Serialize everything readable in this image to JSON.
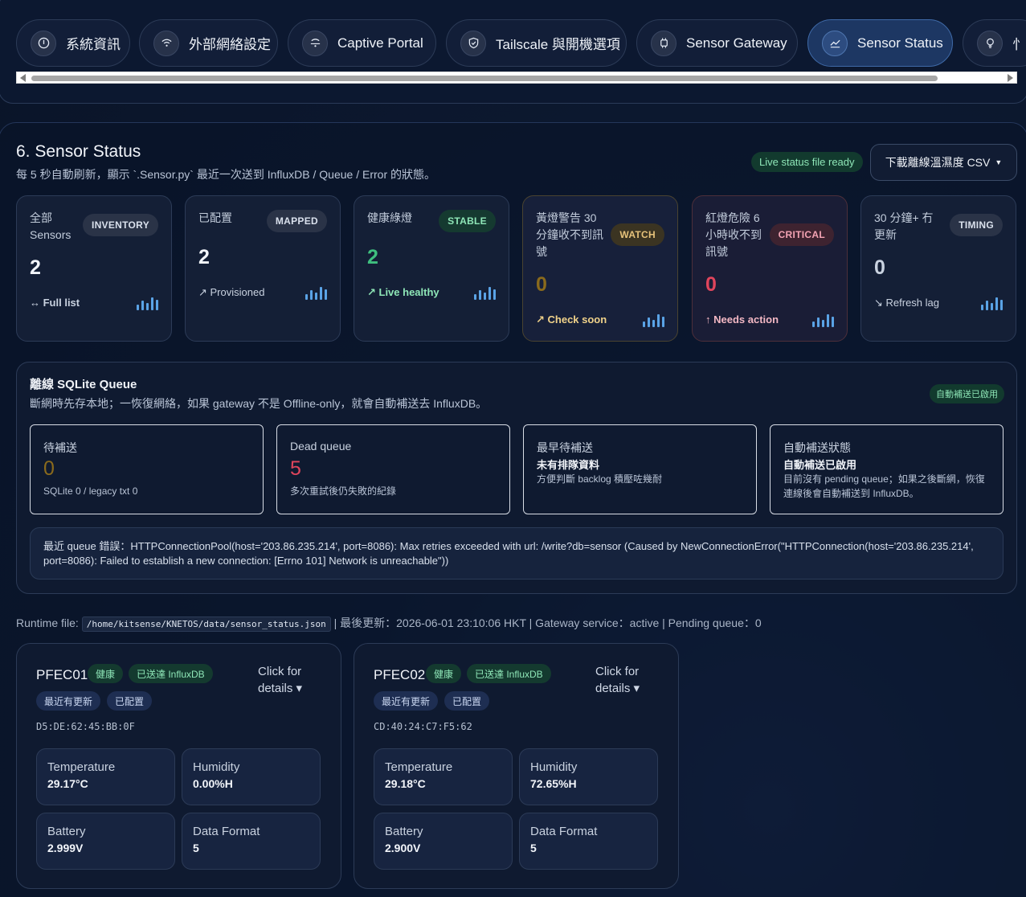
{
  "nav": {
    "tabs": [
      {
        "label": "系統資訊",
        "icon": "info-icon"
      },
      {
        "label": "外部網絡設定",
        "icon": "wifi-icon"
      },
      {
        "label": "Captive Portal",
        "icon": "broadcast-icon"
      },
      {
        "label": "Tailscale 與開機選項",
        "icon": "shield-icon"
      },
      {
        "label": "Sensor Gateway",
        "icon": "chip-icon"
      },
      {
        "label": "Sensor Status",
        "icon": "chart-icon",
        "active": true
      },
      {
        "label": "忄",
        "icon": "bulb-icon"
      }
    ]
  },
  "header": {
    "title": "6. Sensor Status",
    "subtitle": "每 5 秒自動刷新，顯示 `.Sensor.py` 最近一次送到 InfluxDB / Queue / Error 的狀態。",
    "live_badge": "Live status file ready",
    "download_button": "下載離線溫濕度 CSV"
  },
  "metrics": [
    {
      "label": "全部 Sensors",
      "badge": "INVENTORY",
      "value": "2",
      "footer": "↔ Full list"
    },
    {
      "label": "已配置",
      "badge": "MAPPED",
      "value": "2",
      "footer": "↗ Provisioned"
    },
    {
      "label": "健康綠燈",
      "badge": "STABLE",
      "value": "2",
      "footer": "↗ Live healthy"
    },
    {
      "label": "黃燈警告 30 分鐘收不到訊號",
      "badge": "WATCH",
      "value": "0",
      "footer": "↗ Check soon"
    },
    {
      "label": "紅燈危險 6 小時收不到訊號",
      "badge": "CRITICAL",
      "value": "0",
      "footer": "↑ Needs action"
    },
    {
      "label": "30 分鐘+ 冇更新",
      "badge": "TIMING",
      "value": "0",
      "footer": "↘ Refresh lag"
    }
  ],
  "queue": {
    "title": "離線 SQLite Queue",
    "subtitle": "斷網時先存本地；一恢復網絡，如果 gateway 不是 Offline-only，就會自動補送去 InfluxDB。",
    "badge": "自動補送已啟用",
    "pending": {
      "title": "待補送",
      "value": "0",
      "sub": "SQLite 0 / legacy txt 0"
    },
    "dead": {
      "title": "Dead queue",
      "value": "5",
      "sub": "多次重試後仍失敗的紀錄"
    },
    "oldest": {
      "title": "最早待補送",
      "bold": "未有排隊資料",
      "sub": "方便判斷 backlog 積壓咗幾耐"
    },
    "auto": {
      "title": "自動補送狀態",
      "bold": "自動補送已啟用",
      "sub": "目前沒有 pending queue；如果之後斷網，恢復連線後會自動補送到 InfluxDB。"
    },
    "error": "最近 queue 錯誤：HTTPConnectionPool(host='203.86.235.214', port=8086): Max retries exceeded with url: /write?db=sensor (Caused by NewConnectionError(\"HTTPConnection(host='203.86.235.214', port=8086): Failed to establish a new connection: [Errno 101] Network is unreachable\"))"
  },
  "runtime": {
    "label": "Runtime file:",
    "path": "/home/kitsense/KNETOS/data/sensor_status.json",
    "rest": "| 最後更新：2026-06-01 23:10:06 HKT | Gateway service：active | Pending queue：0"
  },
  "sensors": [
    {
      "name": "PFEC01",
      "tags": [
        "健康",
        "已送達 InfluxDB",
        "最近有更新",
        "已配置"
      ],
      "click": "Click for details ▾",
      "mac": "D5:DE:62:45:BB:0F",
      "metrics": [
        {
          "k": "Temperature",
          "v": "29.17°C"
        },
        {
          "k": "Humidity",
          "v": "0.00%H"
        },
        {
          "k": "Battery",
          "v": "2.999V"
        },
        {
          "k": "Data Format",
          "v": "5"
        }
      ]
    },
    {
      "name": "PFEC02",
      "tags": [
        "健康",
        "已送達 InfluxDB",
        "最近有更新",
        "已配置"
      ],
      "click": "Click for details ▾",
      "mac": "CD:40:24:C7:F5:62",
      "metrics": [
        {
          "k": "Temperature",
          "v": "29.18°C"
        },
        {
          "k": "Humidity",
          "v": "72.65%H"
        },
        {
          "k": "Battery",
          "v": "2.900V"
        },
        {
          "k": "Data Format",
          "v": "5"
        }
      ]
    }
  ],
  "colors": {
    "accent": "#5aa3e6",
    "green": "#3fbf7f",
    "amber": "#8a6a1c",
    "red": "#e0455c",
    "live_badge_bg": "#123a2e"
  }
}
